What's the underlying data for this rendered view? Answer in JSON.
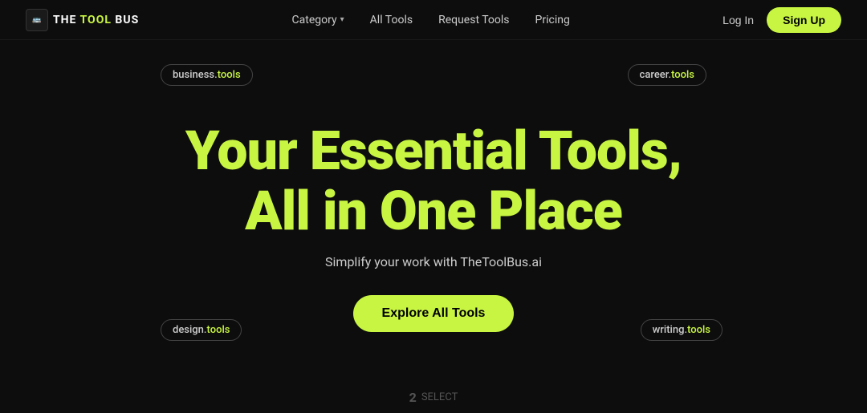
{
  "navbar": {
    "logo": {
      "prefix": "THE ",
      "highlight": "TOOL",
      "suffix": " BUS"
    },
    "links": [
      {
        "label": "Category",
        "hasDropdown": true
      },
      {
        "label": "All Tools",
        "hasDropdown": false
      },
      {
        "label": "Request Tools",
        "hasDropdown": false
      },
      {
        "label": "Pricing",
        "hasDropdown": false
      }
    ],
    "login_label": "Log In",
    "signup_label": "Sign Up"
  },
  "hero": {
    "title": "Your Essential Tools, All in One Place",
    "subtitle": "Simplify your work with TheToolBus.ai",
    "cta_label": "Explore All Tools",
    "tags": [
      {
        "key": "business",
        "text_normal": "business.",
        "text_highlight": "tools",
        "position": "top-left"
      },
      {
        "key": "career",
        "text_normal": "career.",
        "text_highlight": "tools",
        "position": "top-right"
      },
      {
        "key": "design",
        "text_normal": "design.",
        "text_highlight": "tools",
        "position": "bottom-left"
      },
      {
        "key": "writing",
        "text_normal": "writing.",
        "text_highlight": "tools",
        "position": "bottom-right"
      }
    ]
  },
  "footer": {
    "scroll_number": "2",
    "scroll_label": "SELECT"
  },
  "colors": {
    "accent": "#c8f542",
    "background": "#0d0d0d",
    "text_primary": "#ffffff",
    "text_secondary": "#cccccc"
  }
}
